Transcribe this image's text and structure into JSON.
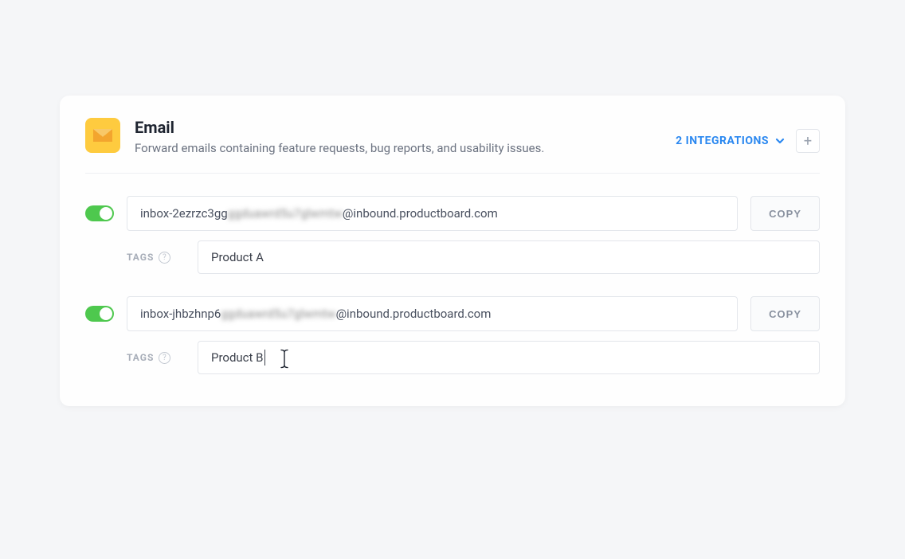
{
  "header": {
    "title": "Email",
    "subtitle": "Forward emails containing feature requests, bug reports, and usability issues.",
    "integrations_label": "2 INTEGRATIONS"
  },
  "integrations": [
    {
      "email_prefix": "inbox-2ezrzc3gg",
      "email_blur": "ggduawrd5u7glwmtw",
      "email_suffix": "@inbound.productboard.com",
      "copy_label": "COPY",
      "tags_label": "TAGS",
      "tags_value": "Product A"
    },
    {
      "email_prefix": "inbox-jhbzhnp6",
      "email_blur": "ggduawrd5u7glwmtw",
      "email_suffix": "@inbound.productboard.com",
      "copy_label": "COPY",
      "tags_label": "TAGS",
      "tags_value": "Product B"
    }
  ]
}
